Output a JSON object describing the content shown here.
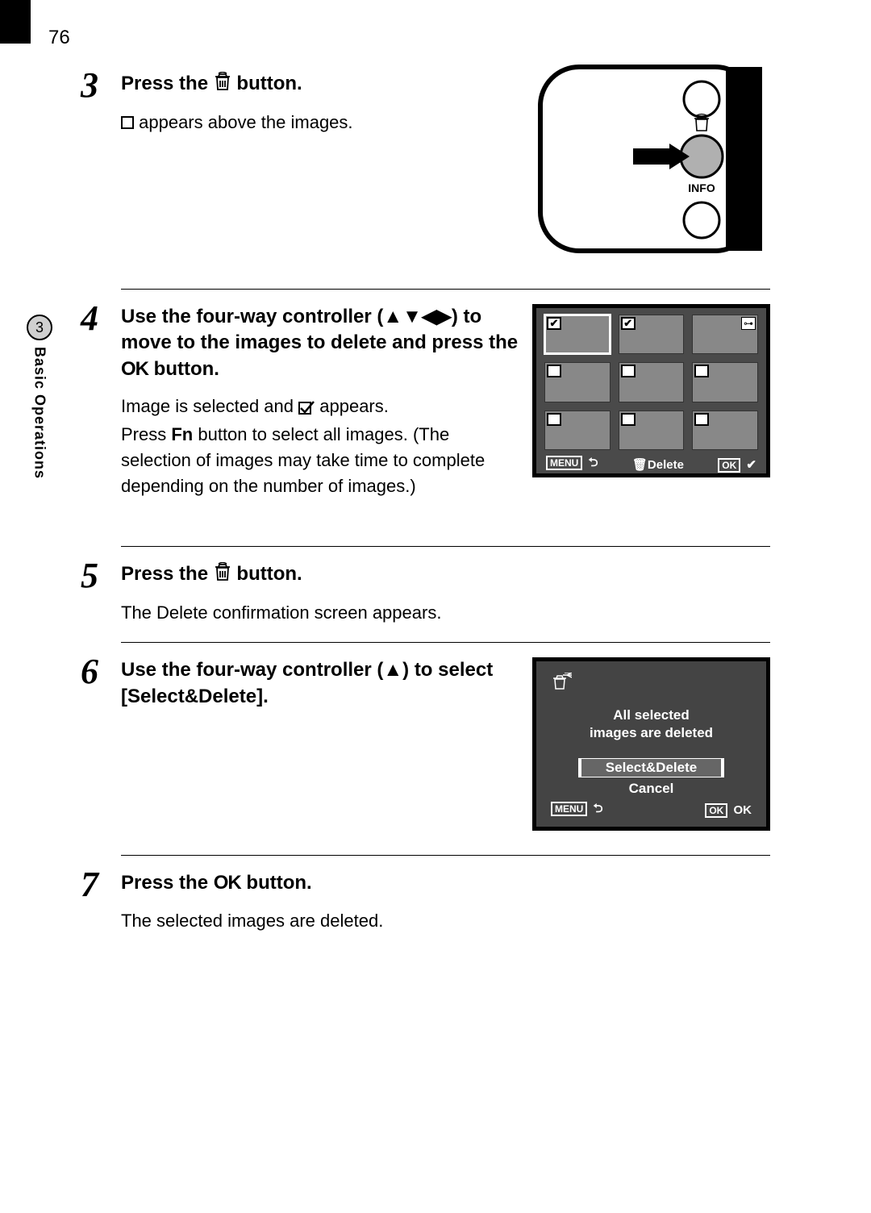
{
  "page_number": "76",
  "side_tab": {
    "number": "3",
    "label": "Basic Operations"
  },
  "step3": {
    "num": "3",
    "title_pre": "Press the ",
    "title_post": " button.",
    "body_post": " appears above the images.",
    "camera_label": "INFO"
  },
  "step4": {
    "num": "4",
    "title_pre": "Use the four-way controller (",
    "title_mid": ") to move to the images to delete and press the ",
    "title_post": " button.",
    "ok_label": "OK",
    "body_l1_pre": "Image is selected and ",
    "body_l1_post": " appears.",
    "body_l2_pre": "Press ",
    "body_l2_fn": "Fn",
    "body_l2_post": " button to select all images. (The selection of images may take time to complete depending on the number of images.)",
    "lcd_footer": {
      "menu": "MENU",
      "delete": "Delete",
      "ok": "OK"
    }
  },
  "step5": {
    "num": "5",
    "title_pre": "Press the ",
    "title_post": " button.",
    "body": "The Delete confirmation screen appears."
  },
  "step6": {
    "num": "6",
    "title_pre": "Use the four-way controller (",
    "title_post": ") to select [Select&Delete].",
    "confirm": {
      "msg_l1": "All selected",
      "msg_l2": "images are deleted",
      "opt1": "Select&Delete",
      "opt2": "Cancel",
      "menu": "MENU",
      "ok_box": "OK",
      "ok_label": "OK"
    }
  },
  "step7": {
    "num": "7",
    "title_pre": "Press the ",
    "ok_label": "OK",
    "title_post": " button.",
    "body": "The selected images are deleted."
  }
}
